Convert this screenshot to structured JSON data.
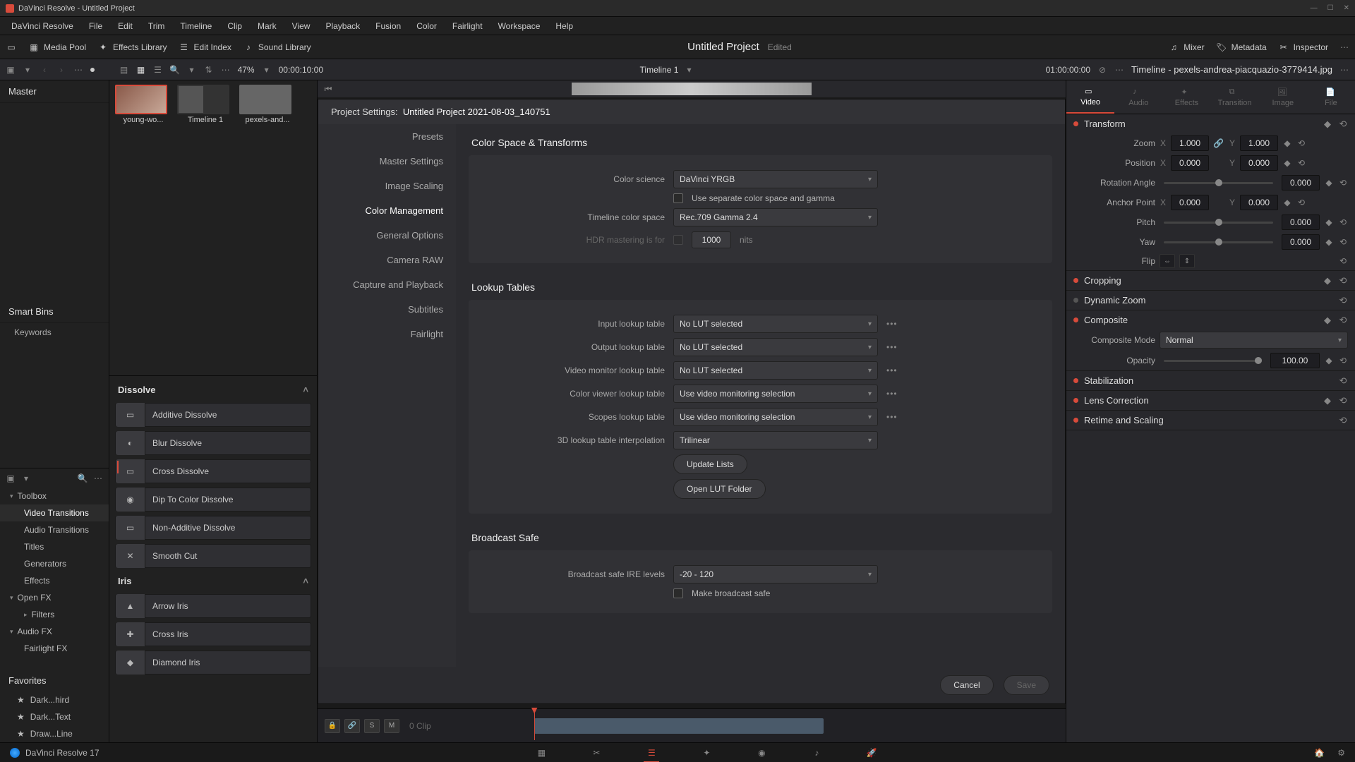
{
  "app_title": "DaVinci Resolve - Untitled Project",
  "menu": [
    "DaVinci Resolve",
    "File",
    "Edit",
    "Trim",
    "Timeline",
    "Clip",
    "Mark",
    "View",
    "Playback",
    "Fusion",
    "Color",
    "Fairlight",
    "Workspace",
    "Help"
  ],
  "toolbar": {
    "media_pool": "Media Pool",
    "effects_library": "Effects Library",
    "edit_index": "Edit Index",
    "sound_library": "Sound Library",
    "project_title": "Untitled Project",
    "project_status": "Edited",
    "mixer": "Mixer",
    "metadata": "Metadata",
    "inspector": "Inspector"
  },
  "secbar": {
    "zoom_pct": "47%",
    "timecode_in": "00:00:10:00",
    "timeline_name": "Timeline 1",
    "timecode_out": "01:00:00:00",
    "inspector_target": "Timeline - pexels-andrea-piacquazio-3779414.jpg"
  },
  "left": {
    "master": "Master",
    "smartbins": "Smart Bins",
    "keywords": "Keywords"
  },
  "clips": [
    {
      "label": "young-wo...",
      "selected": true
    },
    {
      "label": "Timeline 1",
      "selected": false
    },
    {
      "label": "pexels-and...",
      "selected": false
    }
  ],
  "fx_tree": {
    "toolbox": "Toolbox",
    "items": [
      "Video Transitions",
      "Audio Transitions",
      "Titles",
      "Generators",
      "Effects"
    ],
    "openfx": "Open FX",
    "filters": "Filters",
    "audiofx": "Audio FX",
    "fairlightfx": "Fairlight FX",
    "favorites": "Favorites",
    "fav_items": [
      "Dark...hird",
      "Dark...Text",
      "Draw...Line"
    ]
  },
  "fx_list": {
    "group1": "Dissolve",
    "group1_items": [
      "Additive Dissolve",
      "Blur Dissolve",
      "Cross Dissolve",
      "Dip To Color Dissolve",
      "Non-Additive Dissolve",
      "Smooth Cut"
    ],
    "group2": "Iris",
    "group2_items": [
      "Arrow Iris",
      "Cross Iris",
      "Diamond Iris"
    ]
  },
  "modal": {
    "title_prefix": "Project Settings:",
    "title_name": "Untitled Project 2021-08-03_140751",
    "nav": [
      "Presets",
      "Master Settings",
      "Image Scaling",
      "Color Management",
      "General Options",
      "Camera RAW",
      "Capture and Playback",
      "Subtitles",
      "Fairlight"
    ],
    "nav_active": "Color Management",
    "sections": {
      "cst": "Color Space & Transforms",
      "lut": "Lookup Tables",
      "bsafe": "Broadcast Safe"
    },
    "cst": {
      "color_science_label": "Color science",
      "color_science_value": "DaVinci YRGB",
      "separate_label": "Use separate color space and gamma",
      "timeline_cs_label": "Timeline color space",
      "timeline_cs_value": "Rec.709 Gamma 2.4",
      "hdr_label": "HDR mastering is for",
      "hdr_value": "1000",
      "hdr_unit": "nits"
    },
    "lut": {
      "input_label": "Input lookup table",
      "input_value": "No LUT selected",
      "output_label": "Output lookup table",
      "output_value": "No LUT selected",
      "monitor_label": "Video monitor lookup table",
      "monitor_value": "No LUT selected",
      "viewer_label": "Color viewer lookup table",
      "viewer_value": "Use video monitoring selection",
      "scopes_label": "Scopes lookup table",
      "scopes_value": "Use video monitoring selection",
      "interp_label": "3D lookup table interpolation",
      "interp_value": "Trilinear",
      "update": "Update Lists",
      "open_folder": "Open LUT Folder"
    },
    "bsafe": {
      "levels_label": "Broadcast safe IRE levels",
      "levels_value": "-20 - 120",
      "make_label": "Make broadcast safe"
    },
    "cancel": "Cancel",
    "save": "Save"
  },
  "timeline": {
    "clip_count": "0 Clip"
  },
  "inspector": {
    "tabs": [
      "Video",
      "Audio",
      "Effects",
      "Transition",
      "Image",
      "File"
    ],
    "transform": {
      "title": "Transform",
      "zoom": "Zoom",
      "zoom_x": "1.000",
      "zoom_y": "1.000",
      "position": "Position",
      "pos_x": "0.000",
      "pos_y": "0.000",
      "rotation": "Rotation Angle",
      "rotation_v": "0.000",
      "anchor": "Anchor Point",
      "anchor_x": "0.000",
      "anchor_y": "0.000",
      "pitch": "Pitch",
      "pitch_v": "0.000",
      "yaw": "Yaw",
      "yaw_v": "0.000",
      "flip": "Flip"
    },
    "cropping": "Cropping",
    "dynamic_zoom": "Dynamic Zoom",
    "composite": {
      "title": "Composite",
      "mode_label": "Composite Mode",
      "mode_value": "Normal",
      "opacity_label": "Opacity",
      "opacity_value": "100.00"
    },
    "stabilization": "Stabilization",
    "lens": "Lens Correction",
    "retime": "Retime and Scaling"
  },
  "pagebar": {
    "version": "DaVinci Resolve 17"
  }
}
